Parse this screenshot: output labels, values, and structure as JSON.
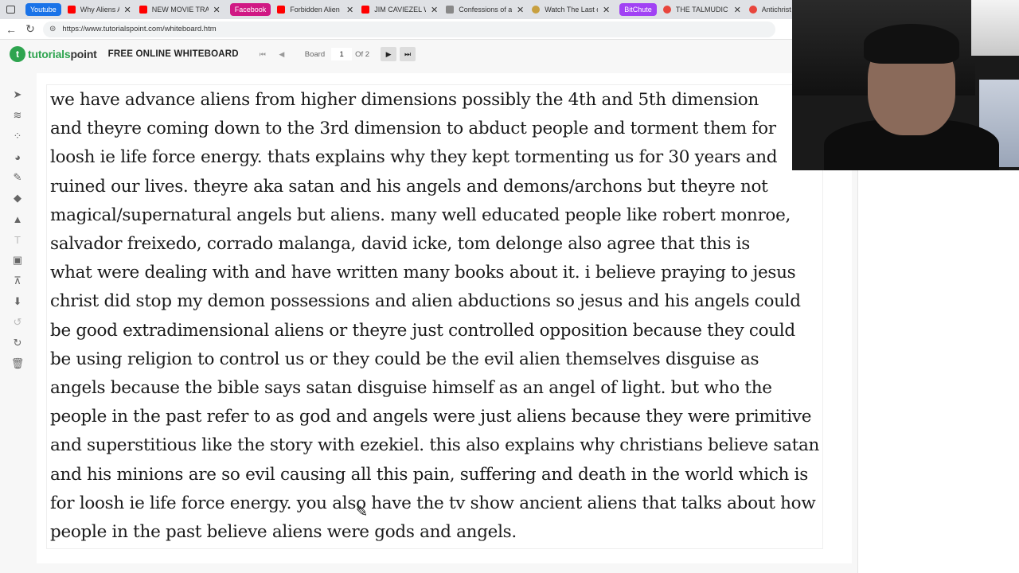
{
  "browser": {
    "tabs": [
      {
        "group": "Youtube",
        "group_color": "#1a73e8",
        "title": "Why Aliens Are Ol",
        "favicon_color": "#ff0000"
      },
      {
        "title": "NEW MOVIE TRAIL",
        "favicon_color": "#ff0000"
      },
      {
        "group": "Facebook",
        "group_color": "#d01884",
        "title": "Forbidden Alien K",
        "favicon_color": "#ff0000"
      },
      {
        "title": "JIM CAVIEZEL WA",
        "favicon_color": "#ff0000"
      },
      {
        "title": "Confessions of an",
        "favicon_color": "#888888"
      },
      {
        "title": "Watch The Last of",
        "favicon_color": "#c8a040"
      },
      {
        "group": "BitChute",
        "group_color": "#a142f4",
        "title": "THE TALMUDIC IN",
        "favicon_color": "#e8453c"
      },
      {
        "title": "Antichrist or Ar",
        "favicon_color": "#e8453c"
      }
    ],
    "url": "https://www.tutorialspoint.com/whiteboard.htm"
  },
  "header": {
    "logo_brand": "tutorials",
    "logo_suffix": "point",
    "logo_mark": "t",
    "title": "FREE ONLINE WHITEBOARD",
    "board_label": "Board",
    "board_value": "1",
    "board_of": "Of 2"
  },
  "tools": [
    "pointer-icon",
    "layers-icon",
    "grid-icon",
    "palette-icon",
    "pencil-icon",
    "eraser-icon",
    "shapes-icon",
    "text-icon",
    "image-icon",
    "present-icon",
    "download-icon",
    "undo-icon",
    "redo-icon",
    "trash-icon"
  ],
  "board_text": [
    "we have advance aliens from higher dimensions possibly the 4th and 5th dimension",
    "and theyre coming down to the 3rd dimension to abduct people and torment them for",
    "loosh ie life force energy. thats explains why they kept tormenting us for 30 years and",
    "ruined our lives. theyre aka satan and his angels and demons/archons but theyre not",
    "magical/supernatural angels but aliens. many well educated people like robert monroe,",
    "salvador freixedo, corrado malanga, david icke, tom delonge also agree that this is",
    "what were dealing with and have written many books about it. i believe praying to jesus",
    "christ did stop my demon possessions and alien abductions so jesus and his angels could",
    "be good extradimensional aliens or theyre just controlled opposition because they could",
    "be using religion to control us or they could be the evil alien themselves disguise as",
    "angels because the bible says satan disguise himself as an angel of light. but who the",
    "people in the past refer to as god and angels were just aliens because they were primitive",
    "and superstitious like the story with ezekiel. this also explains why christians believe satan",
    "and his minions are so evil causing all this pain, suffering and death in the world which is",
    "for loosh ie life force energy. you also have the tv show ancient aliens that talks about how",
    "people in the past believe aliens were gods and angels."
  ]
}
